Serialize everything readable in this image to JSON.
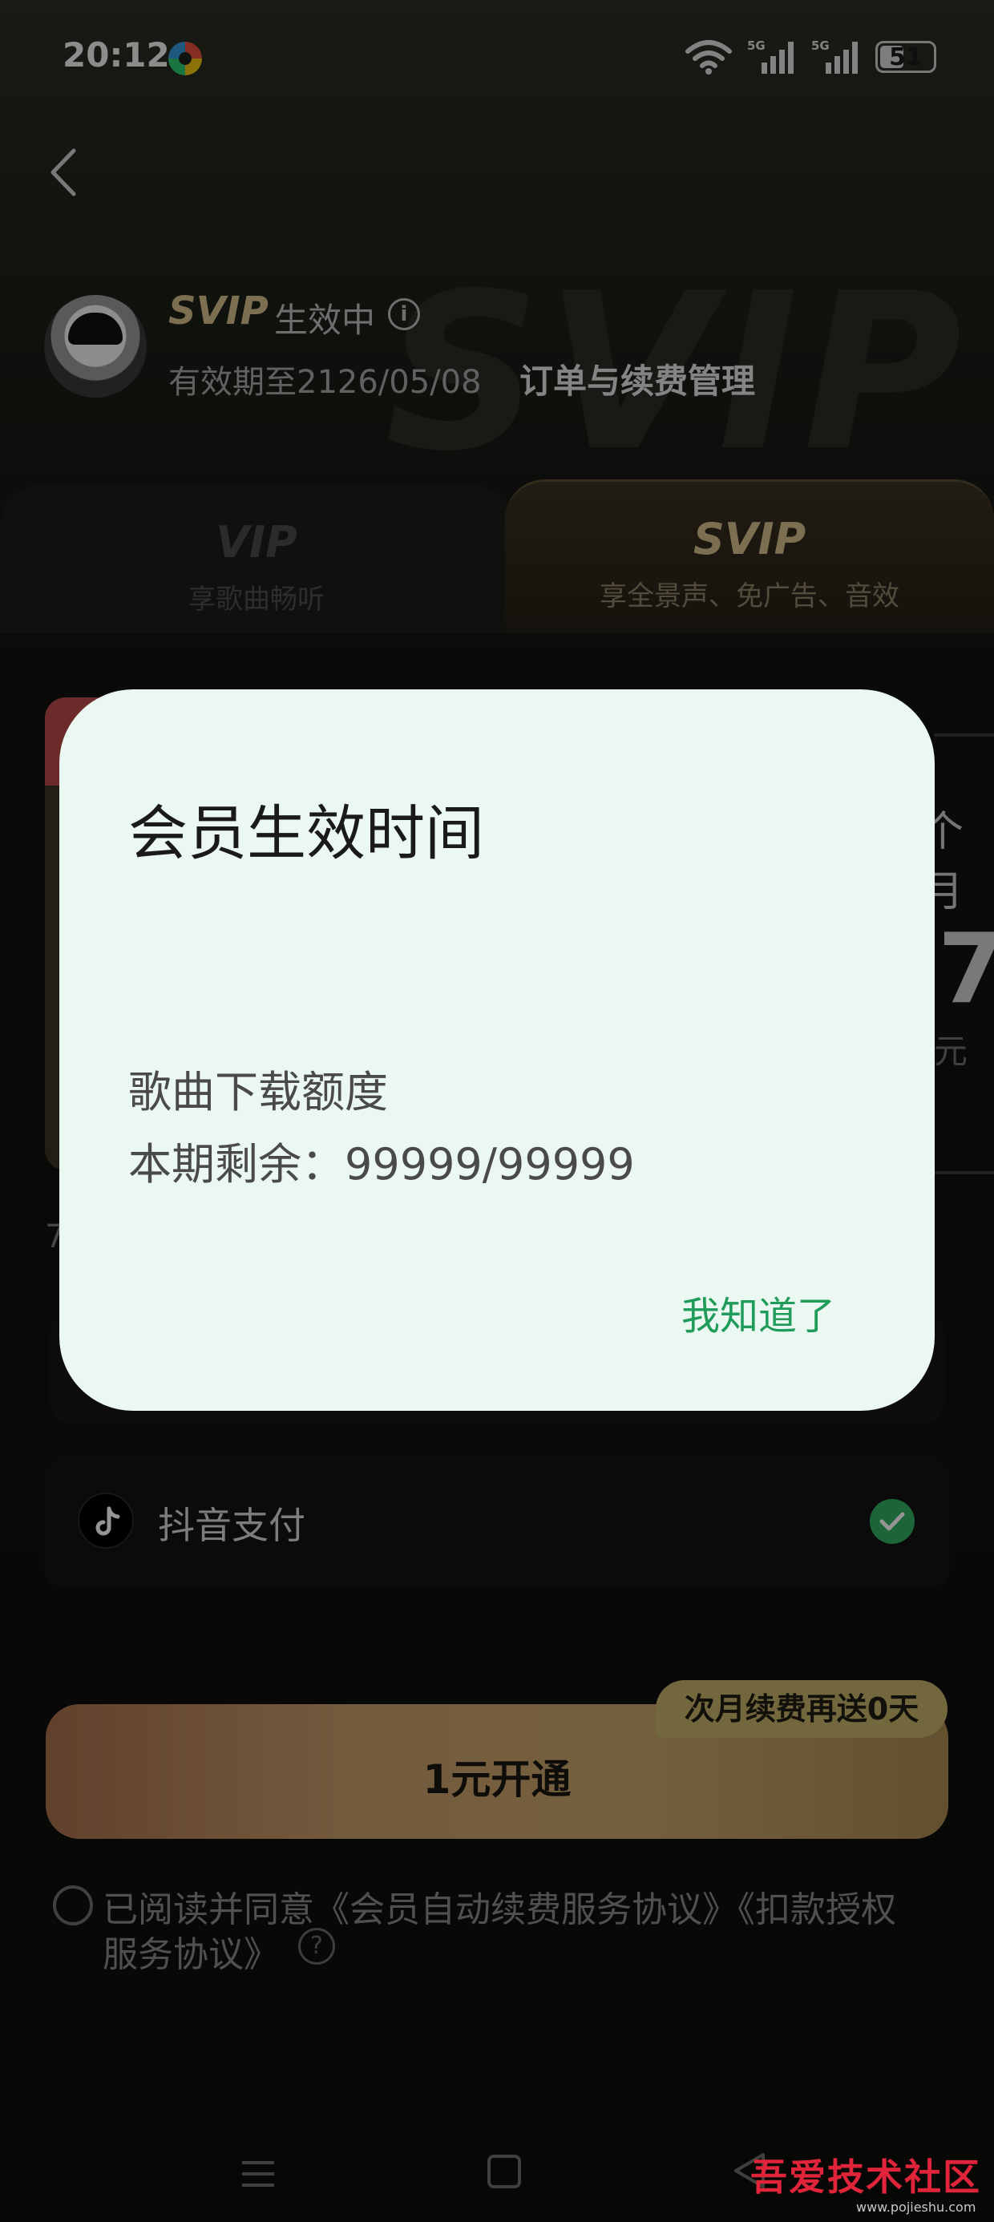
{
  "status_bar": {
    "time": "20:12",
    "network_1": "5G",
    "network_2": "5G",
    "battery": "51"
  },
  "header": {
    "watermark_text": "SVIP",
    "membership_badge": "SVIP",
    "membership_status": "生效中",
    "expiry_text": "有效期至2126/05/08",
    "order_link": "订单与续费管理"
  },
  "tabs": [
    {
      "title": "VIP",
      "subtitle": "享歌曲畅听"
    },
    {
      "title": "SVIP",
      "subtitle": "享全景声、免广告、音效"
    }
  ],
  "background_content": {
    "plan_month_fragment": "个月",
    "plan_price_fragment": "7",
    "plan_unit_fragment": "元",
    "note_fragment": "7"
  },
  "payment": {
    "method_label": "抖音支付"
  },
  "subscribe": {
    "promo_badge": "次月续费再送0天",
    "button_label": "1元开通"
  },
  "agreement": {
    "line_1": "已阅读并同意《会员自动续费服务协议》《扣款授权",
    "line_2": "服务协议》",
    "help_symbol": "?"
  },
  "dialog": {
    "title": "会员生效时间",
    "line_1": "歌曲下载额度",
    "line_2": "本期剩余：99999/99999",
    "confirm_label": "我知道了"
  },
  "watermark": {
    "logo_text": "吾爱技术社区",
    "url": "www.pojieshu.com"
  },
  "colors": {
    "accent_gold": "#d6be8c",
    "confirm_green": "#1f9b5a",
    "check_green": "#2fae62",
    "dialog_bg": "#ebf7f1"
  }
}
